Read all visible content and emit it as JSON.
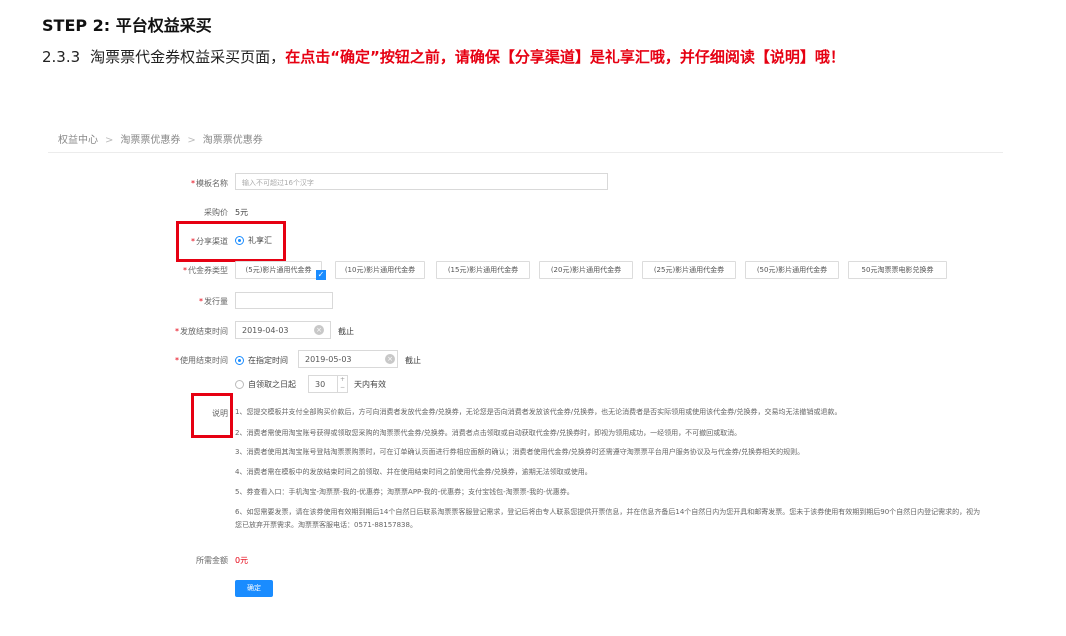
{
  "heading": "STEP 2: 平台权益采买",
  "subline": {
    "number": "2.3.3",
    "text": "淘票票代金券权益采买页面，",
    "highlight": "在点击“确定”按钮之前，请确保【分享渠道】是礼享汇哦，并仔细阅读【说明】哦！"
  },
  "breadcrumb": [
    "权益中心",
    "淘票票优惠券",
    "淘票票优惠券"
  ],
  "breadcrumb_sep": ">",
  "form": {
    "template_name": {
      "label": "模板名称",
      "placeholder": "输入不可超过16个汉字"
    },
    "price": {
      "label": "采购价",
      "value": "5元"
    },
    "channel": {
      "label": "分享渠道",
      "option": "礼享汇"
    },
    "coupon_type": {
      "label": "代金券类型",
      "options": [
        "(5元)影片通用代金券",
        "(10元)影片通用代金券",
        "(15元)影片通用代金券",
        "(20元)影片通用代金券",
        "(25元)影片通用代金券",
        "(50元)影片通用代金券",
        "50元淘票票电影兑换券"
      ],
      "selected_index": 0
    },
    "quantity": {
      "label": "发行量"
    },
    "issue_end": {
      "label": "发放结束时间",
      "value": "2019-04-03",
      "suffix": "截止"
    },
    "use_end": {
      "label": "使用结束时间",
      "option1": "在指定时间",
      "date": "2019-05-03",
      "suffix": "截止",
      "option2": "自领取之日起",
      "days": "30",
      "days_suffix": "天内有效"
    },
    "notes": {
      "label": "说明",
      "items": [
        "1、您提交模板并支付全部购买价款后，方可向消费者发放代金券/兑换券，无论您是否向消费者发放该代金券/兑换券，也无论消费者是否实际领用或使用该代金券/兑换券，交易均无法撤销或退款。",
        "2、消费者需使用淘宝账号获得或领取您采购的淘票票代金券/兑换券。消费者点击领取或自动获取代金券/兑换券时，即视为领用成功，一经领用，不可撤回或取消。",
        "3、消费者使用其淘宝账号登陆淘票票购票时，可在订单确认页面进行券相应面额的确认；消费者使用代金券/兑换券时还需遵守淘票票平台用户服务协议及与代金券/兑换券相关的规则。",
        "4、消费者需在模板中的发放结束时间之前领取、并在使用结束时间之前使用代金券/兑换券，逾期无法领取或使用。",
        "5、券查看入口：手机淘宝-淘票票-我的-优惠券；淘票票APP-我的-优惠券；支付宝钱包-淘票票-我的-优惠券。",
        "6、如您需要发票，请在该券使用有效期到期后14个自然日后联系淘票票客服登记需求，登记后将由专人联系您提供开票信息，并在信息齐备后14个自然日内为您开具和邮寄发票。您未于该券使用有效期到期后90个自然日内登记需求的，视为您已放弃开票需求。淘票票客服电话：0571-88157838。"
      ]
    },
    "total": {
      "label": "所需金额",
      "value": "0元"
    },
    "submit_label": "确定"
  },
  "colors": {
    "highlight_red": "#e60012",
    "primary_blue": "#1a8cff"
  }
}
